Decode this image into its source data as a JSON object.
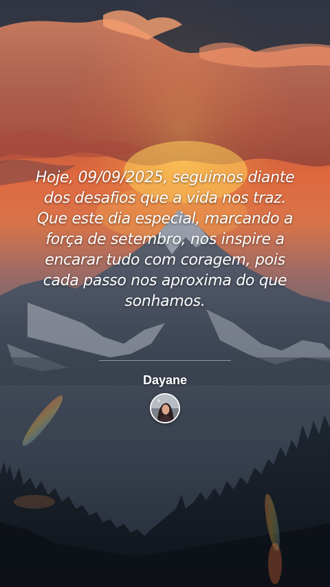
{
  "quote": {
    "text": "Hoje, 09/09/2025, seguimos diante dos desafios que a vida nos traz. Que este dia especial, marcando a força de setembro, nos inspire a encarar tudo com coragem, pois cada passo nos aproxima do que sonhamos."
  },
  "author": {
    "name": "Dayane",
    "avatar_icon": "avatar-photo"
  },
  "background": {
    "icon": "sunset-mountain-landscape",
    "sky_top": "#3a4250",
    "sky_glow": "#e36a3c",
    "sun": "#f2c94c",
    "mountain": "#4e5868",
    "snow": "#c9d0d8",
    "forest": "#141a22"
  }
}
